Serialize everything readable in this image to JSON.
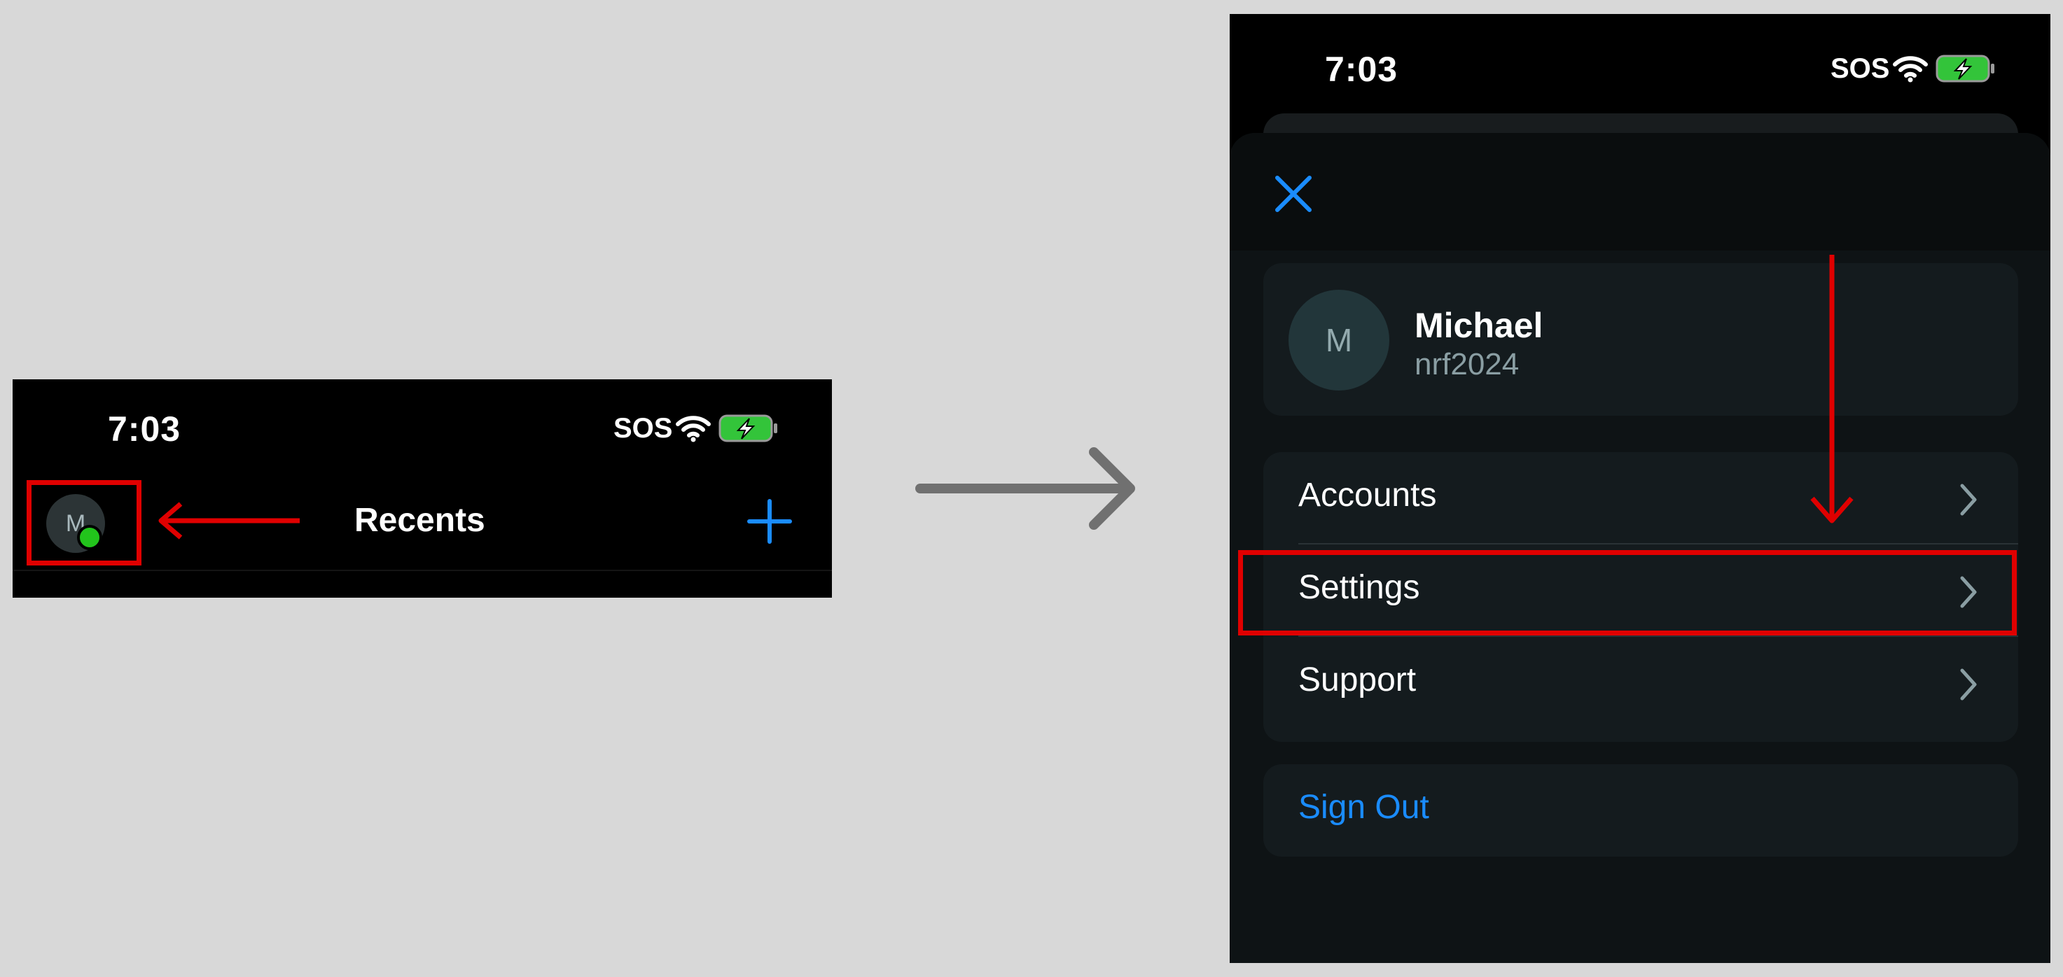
{
  "left": {
    "status_bar": {
      "time": "7:03",
      "sos": "SOS"
    },
    "nav": {
      "avatar_initial": "M",
      "title": "Recents"
    }
  },
  "right": {
    "status_bar": {
      "time": "7:03",
      "sos": "SOS"
    },
    "profile": {
      "initial": "M",
      "name": "Michael",
      "username": "nrf2024"
    },
    "menu": [
      {
        "label": "Accounts"
      },
      {
        "label": "Settings"
      },
      {
        "label": "Support"
      }
    ],
    "sign_out": "Sign Out"
  },
  "colors": {
    "accent_blue": "#1a8cff",
    "highlight_red": "#e00000",
    "presence_green": "#22c41c",
    "battery_green": "#33c43a",
    "transition_arrow_gray": "#707070"
  },
  "icons": [
    "wifi-icon",
    "battery-charging-icon",
    "plus-icon",
    "close-icon",
    "chevron-right-icon",
    "arrow-left-icon",
    "arrow-right-icon",
    "arrow-down-icon"
  ]
}
